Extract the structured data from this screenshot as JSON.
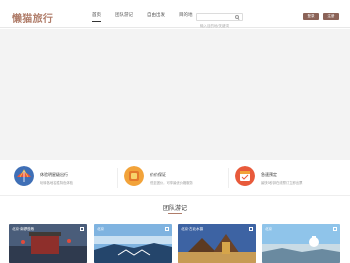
{
  "header": {
    "logo": "懒猫旅行",
    "nav": [
      "首页",
      "团队游记",
      "自由出发",
      "目的地"
    ],
    "active_nav": "首页",
    "search_placeholder": "输入目的地/关键词",
    "login_label": "登录",
    "register_label": "注册"
  },
  "features": [
    {
      "title": "休验明星级出行",
      "desc": "玩转各地名胜特色体验",
      "icon": "globe-umbrella-icon"
    },
    {
      "title": "价价保证",
      "desc": "低至团价，可享最优价格服务",
      "icon": "coin-icon"
    },
    {
      "title": "急速预定",
      "desc": "最快3秒钟在线预订立即出票",
      "icon": "calendar-icon"
    }
  ],
  "section": {
    "title": "团队游记"
  },
  "cards": [
    {
      "location": "北京·南锣鼓巷"
    },
    {
      "location": "北京"
    },
    {
      "location": "北京·古北水镇"
    },
    {
      "location": "北京"
    }
  ],
  "colors": {
    "brand": "#b07d6a",
    "button": "#8b6358",
    "hero_bg": "#f3f3f3"
  }
}
